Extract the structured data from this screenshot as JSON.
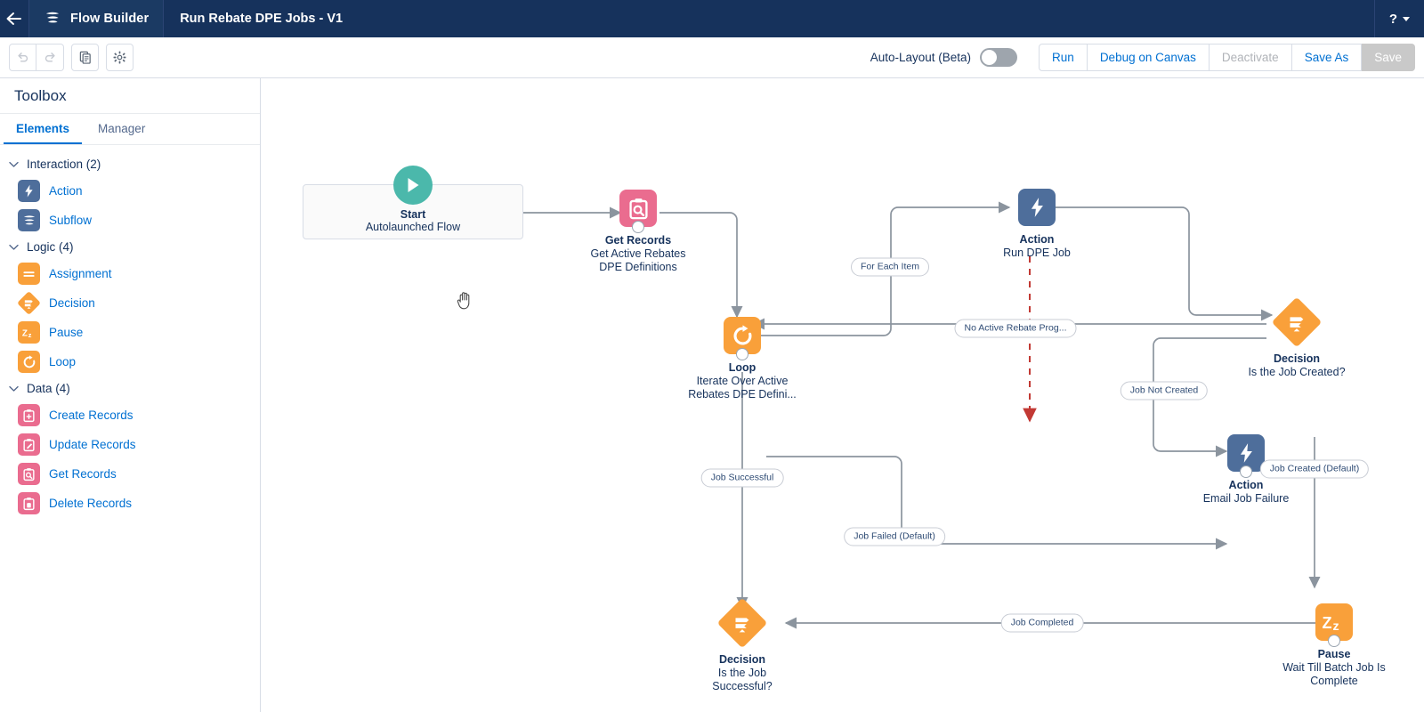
{
  "header": {
    "back_icon": "arrow-left-icon",
    "app_icon": "flow-builder-icon",
    "app_name": "Flow Builder",
    "flow_name": "Run Rebate DPE Jobs - V1",
    "help_label": "?"
  },
  "toolbar": {
    "undo_icon": "undo-icon",
    "redo_icon": "redo-icon",
    "copy_icon": "copy-icon",
    "settings_icon": "gear-icon",
    "autolayout_label": "Auto-Layout (Beta)",
    "autolayout_on": false,
    "buttons": [
      {
        "label": "Run",
        "state": "enabled"
      },
      {
        "label": "Debug on Canvas",
        "state": "enabled"
      },
      {
        "label": "Deactivate",
        "state": "disabled"
      },
      {
        "label": "Save As",
        "state": "enabled"
      },
      {
        "label": "Save",
        "state": "primary-disabled"
      }
    ]
  },
  "sidebar": {
    "title": "Toolbox",
    "tabs": [
      {
        "label": "Elements",
        "active": true
      },
      {
        "label": "Manager",
        "active": false
      }
    ],
    "sections": [
      {
        "label": "Interaction (2)",
        "items": [
          {
            "label": "Action",
            "icon": "action-bolt-icon",
            "color": "blue"
          },
          {
            "label": "Subflow",
            "icon": "subflow-icon",
            "color": "blue"
          }
        ]
      },
      {
        "label": "Logic (4)",
        "items": [
          {
            "label": "Assignment",
            "icon": "assignment-icon",
            "color": "orange"
          },
          {
            "label": "Decision",
            "icon": "decision-icon",
            "color": "diamond"
          },
          {
            "label": "Pause",
            "icon": "pause-zz-icon",
            "color": "orange"
          },
          {
            "label": "Loop",
            "icon": "loop-icon",
            "color": "orange"
          }
        ]
      },
      {
        "label": "Data (4)",
        "items": [
          {
            "label": "Create Records",
            "icon": "create-records-icon",
            "color": "pink"
          },
          {
            "label": "Update Records",
            "icon": "update-records-icon",
            "color": "pink"
          },
          {
            "label": "Get Records",
            "icon": "get-records-icon",
            "color": "pink"
          },
          {
            "label": "Delete Records",
            "icon": "delete-records-icon",
            "color": "pink"
          }
        ]
      }
    ]
  },
  "canvas": {
    "cursor_icon": "grab-hand-cursor",
    "nodes": {
      "start": {
        "title": "Start",
        "subtitle": "Autolaunched Flow",
        "icon": "play-icon"
      },
      "get_records": {
        "title": "Get Records",
        "sub1": "Get Active Rebates",
        "sub2": "DPE Definitions",
        "icon": "get-records-icon"
      },
      "loop": {
        "title": "Loop",
        "sub1": "Iterate Over Active",
        "sub2": "Rebates DPE Defini...",
        "icon": "loop-icon"
      },
      "action_run": {
        "title": "Action",
        "sub1": "Run DPE Job",
        "icon": "action-bolt-icon"
      },
      "decision_created": {
        "title": "Decision",
        "sub1": "Is the Job Created?",
        "icon": "decision-icon"
      },
      "action_email": {
        "title": "Action",
        "sub1": "Email Job Failure",
        "icon": "action-bolt-icon"
      },
      "decision_success": {
        "title": "Decision",
        "sub1": "Is the Job",
        "sub2": "Successful?",
        "icon": "decision-icon"
      },
      "pause": {
        "title": "Pause",
        "sub1": "Wait Till Batch Job Is",
        "sub2": "Complete",
        "icon": "pause-zz-icon"
      }
    },
    "connector_labels": {
      "for_each_item": "For Each Item",
      "no_active_rebate": "No Active Rebate Prog...",
      "job_not_created": "Job Not Created",
      "job_created_default": "Job Created (Default)",
      "job_successful": "Job Successful",
      "job_failed_default": "Job Failed (Default)",
      "job_completed": "Job Completed"
    }
  },
  "colors": {
    "header_bg": "#16325c",
    "link_blue": "#0070d2",
    "orange": "#f9a03a",
    "pink": "#ea6c8f",
    "navy_icon": "#4e6e9b",
    "teal": "#4bb8ab",
    "wire": "#8b949e",
    "fault_red": "#c23934"
  }
}
